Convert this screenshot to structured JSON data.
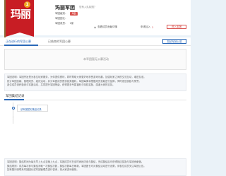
{
  "flag": {
    "text": "玛丽",
    "badge": "1"
  },
  "corp": {
    "name": "玛丽军团",
    "join_hint": "您有入队权限？",
    "level_label": "军团级别：",
    "level_value": "1级",
    "leader_label": "军团团长：",
    "leader_value": "",
    "members_label": "军团成员：",
    "members_value": "1家"
  },
  "stats": {
    "members_ranking_label": "查看成员贡献详情",
    "apply_label": "申请加入",
    "apply_value": "1",
    "join_button": "进入军团"
  },
  "tabs": {
    "active": "正在进行的军团公募",
    "inactive": "已结束的军团公募",
    "publish": "发起军团公募"
  },
  "empty": {
    "text": "本军团暂无公募活动"
  },
  "notice": {
    "label": "军团公告：",
    "lines": [
      "军团说明：军团宗旨是为各位玩家服务，为你提供便利，同时帮助大家更好地享受游戏乐趣，加强玩家之间的交流互动，增进友谊。",
      "统计军团贡献、管理成员、组织活动，并为军团成员提供各类福利。军团每周将根据成员贡献进行结算，同时发放奖励与荣誉。",
      "各位成员请积极参与军团活动，共同提升军团等级，获得更多专属福利与特权奖励，感谢大家的支持。"
    ]
  },
  "records": {
    "title": "军团集结记录",
    "first": "该军团暂无集结记录",
    "more": "⋮"
  },
  "bottom_notice": {
    "lines": [
      "军团说明：集结时间为每天早上九点至晚上九点，军团成员可在该时间段内参与集结，完成集结后可获得相应奖励与军团贡献值。",
      "集结规则：成员每次参与集结消耗一次集结次数，集结次数每日刷新，军团团长可对集结活动进行设置，请各位成员关注军团公告。",
      "如有疑问请联系军团团长或军团管理员进行咨询，祝大家游戏愉快。"
    ]
  },
  "colors": {
    "brand_red": "#c81d24",
    "link_blue": "#2a68b8",
    "badge_orange": "#f0a623"
  }
}
